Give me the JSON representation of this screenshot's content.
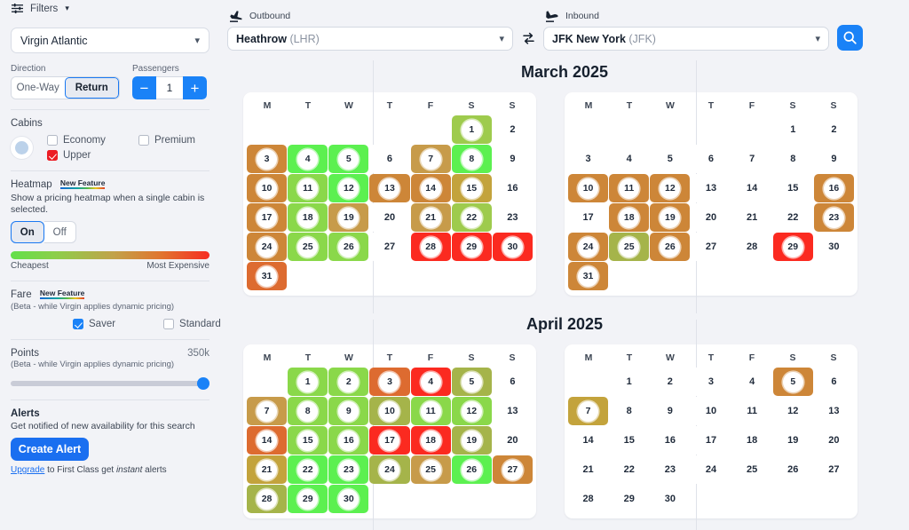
{
  "sidebar": {
    "filters_label": "Filters",
    "filters_chevron": "chevron-down-icon",
    "airline": {
      "value": "Virgin Atlantic"
    },
    "direction": {
      "label": "Direction",
      "options": [
        "One-Way",
        "Return"
      ],
      "selected": "Return"
    },
    "passengers": {
      "label": "Passengers",
      "value": "1",
      "minus": "−",
      "plus": "+"
    },
    "cabins": {
      "title": "Cabins",
      "options": [
        {
          "label": "Economy",
          "checked": false
        },
        {
          "label": "Premium",
          "checked": false
        },
        {
          "label": "Upper",
          "checked": true
        }
      ]
    },
    "heatmap": {
      "title": "Heatmap",
      "badge": "New Feature",
      "description": "Show a pricing heatmap when a single cabin is selected.",
      "on_label": "On",
      "off_label": "Off",
      "selected": "On",
      "legend_low": "Cheapest",
      "legend_high": "Most Expensive"
    },
    "fare": {
      "title": "Fare",
      "badge": "New Feature",
      "note": "(Beta - while Virgin applies dynamic pricing)",
      "options": [
        {
          "label": "Saver",
          "checked": true
        },
        {
          "label": "Standard",
          "checked": false
        }
      ]
    },
    "points": {
      "title": "Points",
      "value": "350k",
      "note": "(Beta - while Virgin applies dynamic pricing)"
    },
    "alerts": {
      "title": "Alerts",
      "subtitle": "Get notified of new availability for this search",
      "button": "Create Alert",
      "upgrade_link": "Upgrade",
      "upgrade_mid": " to First Class get ",
      "upgrade_em": "instant",
      "upgrade_end": " alerts"
    }
  },
  "route": {
    "outbound": {
      "heading": "Outbound",
      "icon": "takeoff-icon",
      "name": "Heathrow",
      "code": "(LHR)"
    },
    "inbound": {
      "heading": "Inbound",
      "icon": "landing-icon",
      "name": "JFK New York",
      "code": "(JFK)"
    },
    "swap_icon": "swap-arrows-icon",
    "search_icon": "search-icon"
  },
  "calendar": {
    "dow": [
      "M",
      "T",
      "W",
      "T",
      "F",
      "S",
      "S"
    ],
    "colors": {
      "green_bright": "#5cf050",
      "green": "#8ad84a",
      "green_mid": "#9ecb4d",
      "olive": "#a5b44a",
      "gold": "#c3a33c",
      "tan": "#c79b4a",
      "brown": "#cd8638",
      "orange": "#dd6b30",
      "red": "#fb2a20",
      "plain": "#ffffff"
    },
    "months": [
      {
        "title": "March 2025",
        "outbound": {
          "lead_blanks": 5,
          "days": [
            {
              "d": 1,
              "c": "green_mid",
              "sel": true
            },
            {
              "d": 2,
              "c": "plain",
              "sel": false
            },
            {
              "d": 3,
              "c": "brown",
              "sel": true
            },
            {
              "d": 4,
              "c": "green_bright",
              "sel": true
            },
            {
              "d": 5,
              "c": "green_bright",
              "sel": true
            },
            {
              "d": 6,
              "c": "plain",
              "sel": false
            },
            {
              "d": 7,
              "c": "tan",
              "sel": true
            },
            {
              "d": 8,
              "c": "green_bright",
              "sel": true
            },
            {
              "d": 9,
              "c": "plain",
              "sel": false
            },
            {
              "d": 10,
              "c": "brown",
              "sel": true
            },
            {
              "d": 11,
              "c": "green",
              "sel": true
            },
            {
              "d": 12,
              "c": "green_bright",
              "sel": true
            },
            {
              "d": 13,
              "c": "brown",
              "sel": true
            },
            {
              "d": 14,
              "c": "brown",
              "sel": true
            },
            {
              "d": 15,
              "c": "gold",
              "sel": true
            },
            {
              "d": 16,
              "c": "plain",
              "sel": false
            },
            {
              "d": 17,
              "c": "brown",
              "sel": true
            },
            {
              "d": 18,
              "c": "green",
              "sel": true
            },
            {
              "d": 19,
              "c": "tan",
              "sel": true
            },
            {
              "d": 20,
              "c": "plain",
              "sel": false
            },
            {
              "d": 21,
              "c": "tan",
              "sel": true
            },
            {
              "d": 22,
              "c": "green_mid",
              "sel": true
            },
            {
              "d": 23,
              "c": "plain",
              "sel": false
            },
            {
              "d": 24,
              "c": "brown",
              "sel": true
            },
            {
              "d": 25,
              "c": "green",
              "sel": true
            },
            {
              "d": 26,
              "c": "green",
              "sel": true
            },
            {
              "d": 27,
              "c": "plain",
              "sel": false
            },
            {
              "d": 28,
              "c": "red",
              "sel": true
            },
            {
              "d": 29,
              "c": "red",
              "sel": true
            },
            {
              "d": 30,
              "c": "red",
              "sel": true
            },
            {
              "d": 31,
              "c": "orange",
              "sel": true
            }
          ]
        },
        "inbound": {
          "lead_blanks": 5,
          "days": [
            {
              "d": 1,
              "c": "plain",
              "sel": false
            },
            {
              "d": 2,
              "c": "plain",
              "sel": false
            },
            {
              "d": 3,
              "c": "plain",
              "sel": false
            },
            {
              "d": 4,
              "c": "plain",
              "sel": false
            },
            {
              "d": 5,
              "c": "plain",
              "sel": false
            },
            {
              "d": 6,
              "c": "plain",
              "sel": false
            },
            {
              "d": 7,
              "c": "plain",
              "sel": false
            },
            {
              "d": 8,
              "c": "plain",
              "sel": false
            },
            {
              "d": 9,
              "c": "plain",
              "sel": false
            },
            {
              "d": 10,
              "c": "brown",
              "sel": true
            },
            {
              "d": 11,
              "c": "brown",
              "sel": true
            },
            {
              "d": 12,
              "c": "brown",
              "sel": true
            },
            {
              "d": 13,
              "c": "plain",
              "sel": false
            },
            {
              "d": 14,
              "c": "plain",
              "sel": false
            },
            {
              "d": 15,
              "c": "plain",
              "sel": false
            },
            {
              "d": 16,
              "c": "brown",
              "sel": true
            },
            {
              "d": 17,
              "c": "plain",
              "sel": false
            },
            {
              "d": 18,
              "c": "brown",
              "sel": true
            },
            {
              "d": 19,
              "c": "brown",
              "sel": true
            },
            {
              "d": 20,
              "c": "plain",
              "sel": false
            },
            {
              "d": 21,
              "c": "plain",
              "sel": false
            },
            {
              "d": 22,
              "c": "plain",
              "sel": false
            },
            {
              "d": 23,
              "c": "brown",
              "sel": true
            },
            {
              "d": 24,
              "c": "brown",
              "sel": true
            },
            {
              "d": 25,
              "c": "olive",
              "sel": true
            },
            {
              "d": 26,
              "c": "brown",
              "sel": true
            },
            {
              "d": 27,
              "c": "plain",
              "sel": false
            },
            {
              "d": 28,
              "c": "plain",
              "sel": false
            },
            {
              "d": 29,
              "c": "red",
              "sel": true
            },
            {
              "d": 30,
              "c": "plain",
              "sel": false
            },
            {
              "d": 31,
              "c": "brown",
              "sel": true
            }
          ]
        }
      },
      {
        "title": "April 2025",
        "outbound": {
          "lead_blanks": 1,
          "days": [
            {
              "d": 1,
              "c": "green",
              "sel": true
            },
            {
              "d": 2,
              "c": "green",
              "sel": true
            },
            {
              "d": 3,
              "c": "orange",
              "sel": true
            },
            {
              "d": 4,
              "c": "red",
              "sel": true
            },
            {
              "d": 5,
              "c": "olive",
              "sel": true
            },
            {
              "d": 6,
              "c": "plain",
              "sel": false
            },
            {
              "d": 7,
              "c": "tan",
              "sel": true
            },
            {
              "d": 8,
              "c": "green",
              "sel": true
            },
            {
              "d": 9,
              "c": "green",
              "sel": true
            },
            {
              "d": 10,
              "c": "olive",
              "sel": true
            },
            {
              "d": 11,
              "c": "green",
              "sel": true
            },
            {
              "d": 12,
              "c": "green",
              "sel": true
            },
            {
              "d": 13,
              "c": "plain",
              "sel": false
            },
            {
              "d": 14,
              "c": "orange",
              "sel": true
            },
            {
              "d": 15,
              "c": "green",
              "sel": true
            },
            {
              "d": 16,
              "c": "green",
              "sel": true
            },
            {
              "d": 17,
              "c": "red",
              "sel": true
            },
            {
              "d": 18,
              "c": "red",
              "sel": true
            },
            {
              "d": 19,
              "c": "olive",
              "sel": true
            },
            {
              "d": 20,
              "c": "plain",
              "sel": false
            },
            {
              "d": 21,
              "c": "gold",
              "sel": true
            },
            {
              "d": 22,
              "c": "green_bright",
              "sel": true
            },
            {
              "d": 23,
              "c": "green_bright",
              "sel": true
            },
            {
              "d": 24,
              "c": "olive",
              "sel": true
            },
            {
              "d": 25,
              "c": "tan",
              "sel": true
            },
            {
              "d": 26,
              "c": "green_bright",
              "sel": true
            },
            {
              "d": 27,
              "c": "brown",
              "sel": true
            },
            {
              "d": 28,
              "c": "olive",
              "sel": true
            },
            {
              "d": 29,
              "c": "green_bright",
              "sel": true
            },
            {
              "d": 30,
              "c": "green_bright",
              "sel": true
            }
          ]
        },
        "inbound": {
          "lead_blanks": 1,
          "days": [
            {
              "d": 1,
              "c": "plain",
              "sel": false
            },
            {
              "d": 2,
              "c": "plain",
              "sel": false
            },
            {
              "d": 3,
              "c": "plain",
              "sel": false
            },
            {
              "d": 4,
              "c": "plain",
              "sel": false
            },
            {
              "d": 5,
              "c": "brown",
              "sel": true
            },
            {
              "d": 6,
              "c": "plain",
              "sel": false
            },
            {
              "d": 7,
              "c": "gold",
              "sel": true
            },
            {
              "d": 8,
              "c": "plain",
              "sel": false
            },
            {
              "d": 9,
              "c": "plain",
              "sel": false
            },
            {
              "d": 10,
              "c": "plain",
              "sel": false
            },
            {
              "d": 11,
              "c": "plain",
              "sel": false
            },
            {
              "d": 12,
              "c": "plain",
              "sel": false
            },
            {
              "d": 13,
              "c": "plain",
              "sel": false
            },
            {
              "d": 14,
              "c": "plain",
              "sel": false
            },
            {
              "d": 15,
              "c": "plain",
              "sel": false
            },
            {
              "d": 16,
              "c": "plain",
              "sel": false
            },
            {
              "d": 17,
              "c": "plain",
              "sel": false
            },
            {
              "d": 18,
              "c": "plain",
              "sel": false
            },
            {
              "d": 19,
              "c": "plain",
              "sel": false
            },
            {
              "d": 20,
              "c": "plain",
              "sel": false
            },
            {
              "d": 21,
              "c": "plain",
              "sel": false
            },
            {
              "d": 22,
              "c": "plain",
              "sel": false
            },
            {
              "d": 23,
              "c": "plain",
              "sel": false
            },
            {
              "d": 24,
              "c": "plain",
              "sel": false
            },
            {
              "d": 25,
              "c": "plain",
              "sel": false
            },
            {
              "d": 26,
              "c": "plain",
              "sel": false
            },
            {
              "d": 27,
              "c": "plain",
              "sel": false
            },
            {
              "d": 28,
              "c": "plain",
              "sel": false
            },
            {
              "d": 29,
              "c": "plain",
              "sel": false
            },
            {
              "d": 30,
              "c": "plain",
              "sel": false
            }
          ]
        }
      }
    ]
  }
}
